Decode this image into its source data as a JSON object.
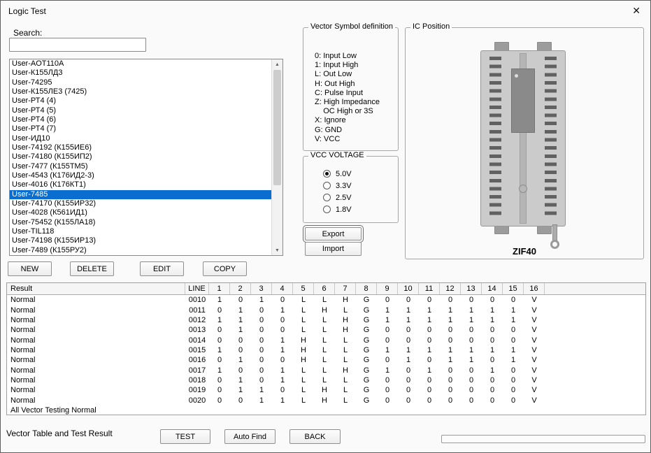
{
  "window": {
    "title": "Logic Test",
    "close_glyph": "✕"
  },
  "colors": {
    "selection_blue": "#0a6ed1"
  },
  "search": {
    "label": "Search:",
    "value": ""
  },
  "device_list": {
    "selected_index": 14,
    "items": [
      "User-AOT110A",
      "User-К155ЛД3",
      "User-74295",
      "User-К155ЛЕ3 (7425)",
      "User-РТ4 (4)",
      "User-РТ4 (5)",
      "User-РТ4 (6)",
      "User-РТ4 (7)",
      "User-ИД10",
      "User-74192 (К155ИЕ6)",
      "User-74180 (К155ИП2)",
      "User-7477 (К155ТМ5)",
      "User-4543 (К176ИД2-3)",
      "User-4016 (К176КТ1)",
      "User-7485",
      "User-74170 (К155ИР32)",
      "User-4028 (К561ИД1)",
      "User-75452 (К155ЛА18)",
      "User-TIL118",
      "User-74198 (К155ИР13)",
      "User-7489 (К155РУ2)"
    ]
  },
  "list_buttons": {
    "new": "NEW",
    "delete": "DELETE",
    "edit": "EDIT",
    "copy": "COPY"
  },
  "vector_symbols": {
    "title": "Vector Symbol definition",
    "lines": [
      "0: Input Low",
      "1: Input High",
      "L: Out Low",
      "H: Out High",
      "C: Pulse Input",
      "Z: High Impedance",
      "    OC High or 3S",
      "X: Ignore",
      "G: GND",
      "V: VCC"
    ]
  },
  "vcc": {
    "title": "VCC VOLTAGE",
    "options": [
      {
        "label": "5.0V",
        "selected": true
      },
      {
        "label": "3.3V",
        "selected": false
      },
      {
        "label": "2.5V",
        "selected": false
      },
      {
        "label": "1.8V",
        "selected": false
      }
    ]
  },
  "actions": {
    "export": "Export",
    "import": "Import"
  },
  "ic_position": {
    "title": "IC Position",
    "socket_label": "ZIF40"
  },
  "result_table": {
    "headers": [
      "Result",
      "LINE",
      "1",
      "2",
      "3",
      "4",
      "5",
      "6",
      "7",
      "8",
      "9",
      "10",
      "11",
      "12",
      "13",
      "14",
      "15",
      "16"
    ],
    "rows": [
      {
        "result": "Normal",
        "line": "0010",
        "pins": [
          "1",
          "0",
          "1",
          "0",
          "L",
          "L",
          "H",
          "G",
          "0",
          "0",
          "0",
          "0",
          "0",
          "0",
          "0",
          "V"
        ]
      },
      {
        "result": "Normal",
        "line": "0011",
        "pins": [
          "0",
          "1",
          "0",
          "1",
          "L",
          "H",
          "L",
          "G",
          "1",
          "1",
          "1",
          "1",
          "1",
          "1",
          "1",
          "V"
        ]
      },
      {
        "result": "Normal",
        "line": "0012",
        "pins": [
          "1",
          "1",
          "0",
          "0",
          "L",
          "L",
          "H",
          "G",
          "1",
          "1",
          "1",
          "1",
          "1",
          "1",
          "1",
          "V"
        ]
      },
      {
        "result": "Normal",
        "line": "0013",
        "pins": [
          "0",
          "1",
          "0",
          "0",
          "L",
          "L",
          "H",
          "G",
          "0",
          "0",
          "0",
          "0",
          "0",
          "0",
          "0",
          "V"
        ]
      },
      {
        "result": "Normal",
        "line": "0014",
        "pins": [
          "0",
          "0",
          "0",
          "1",
          "H",
          "L",
          "L",
          "G",
          "0",
          "0",
          "0",
          "0",
          "0",
          "0",
          "0",
          "V"
        ]
      },
      {
        "result": "Normal",
        "line": "0015",
        "pins": [
          "1",
          "0",
          "0",
          "1",
          "H",
          "L",
          "L",
          "G",
          "1",
          "1",
          "1",
          "1",
          "1",
          "1",
          "1",
          "V"
        ]
      },
      {
        "result": "Normal",
        "line": "0016",
        "pins": [
          "0",
          "1",
          "0",
          "0",
          "H",
          "L",
          "L",
          "G",
          "0",
          "1",
          "0",
          "1",
          "1",
          "0",
          "1",
          "V"
        ]
      },
      {
        "result": "Normal",
        "line": "0017",
        "pins": [
          "1",
          "0",
          "0",
          "1",
          "L",
          "L",
          "H",
          "G",
          "1",
          "0",
          "1",
          "0",
          "0",
          "1",
          "0",
          "V"
        ]
      },
      {
        "result": "Normal",
        "line": "0018",
        "pins": [
          "0",
          "1",
          "0",
          "1",
          "L",
          "L",
          "L",
          "G",
          "0",
          "0",
          "0",
          "0",
          "0",
          "0",
          "0",
          "V"
        ]
      },
      {
        "result": "Normal",
        "line": "0019",
        "pins": [
          "0",
          "1",
          "1",
          "0",
          "L",
          "H",
          "L",
          "G",
          "0",
          "0",
          "0",
          "0",
          "0",
          "0",
          "0",
          "V"
        ]
      },
      {
        "result": "Normal",
        "line": "0020",
        "pins": [
          "0",
          "0",
          "1",
          "1",
          "L",
          "H",
          "L",
          "G",
          "0",
          "0",
          "0",
          "0",
          "0",
          "0",
          "0",
          "V"
        ]
      }
    ],
    "footer": "All Vector Testing Normal"
  },
  "bottom": {
    "status_label": "Vector Table and Test Result",
    "test": "TEST",
    "auto_find": "Auto Find",
    "back": "BACK"
  }
}
